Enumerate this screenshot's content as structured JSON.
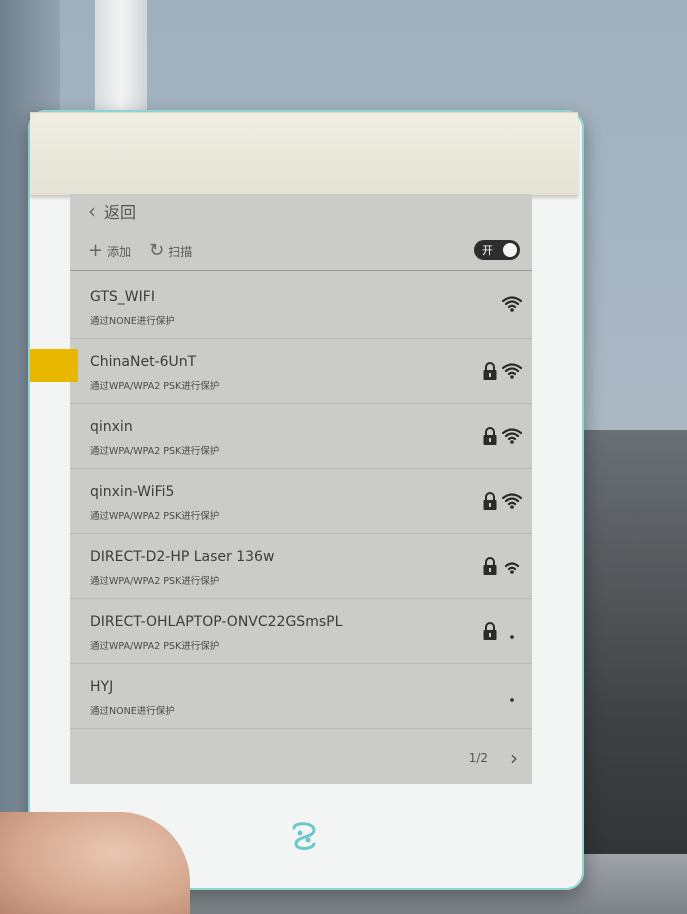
{
  "nav": {
    "back_label": "返回"
  },
  "toolbar": {
    "add_label": "添加",
    "scan_label": "扫描",
    "toggle_label": "开"
  },
  "networks": [
    {
      "ssid": "GTS_WIFI",
      "security": "通过NONE进行保护",
      "locked": false,
      "signal": 4
    },
    {
      "ssid": "ChinaNet-6UnT",
      "security": "通过WPA/WPA2 PSK进行保护",
      "locked": true,
      "signal": 4
    },
    {
      "ssid": "qinxin",
      "security": "通过WPA/WPA2 PSK进行保护",
      "locked": true,
      "signal": 4
    },
    {
      "ssid": "qinxin-WiFi5",
      "security": "通过WPA/WPA2 PSK进行保护",
      "locked": true,
      "signal": 4
    },
    {
      "ssid": "DIRECT-D2-HP Laser 136w",
      "security": "通过WPA/WPA2 PSK进行保护",
      "locked": true,
      "signal": 3
    },
    {
      "ssid": "DIRECT-OHLAPTOP-ONVC22GSmsPL",
      "security": "通过WPA/WPA2 PSK进行保护",
      "locked": true,
      "signal": 1
    },
    {
      "ssid": "HYJ",
      "security": "通过NONE进行保护",
      "locked": false,
      "signal": 1
    }
  ],
  "pagination": {
    "page": "1/2"
  },
  "colors": {
    "screen": "#cbcbc8",
    "device_frame": "#f3f5f5",
    "accent_teal": "#8fd3d3",
    "tape_yellow": "#e8b800"
  }
}
